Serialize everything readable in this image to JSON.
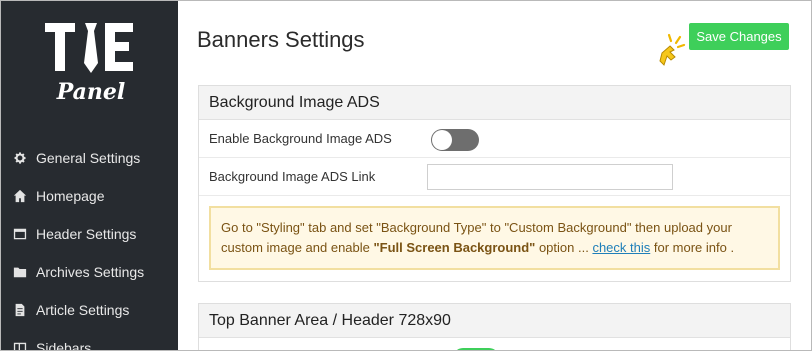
{
  "sidebar": {
    "logo_text": "TiE Panel",
    "items": [
      {
        "label": "General Settings",
        "icon": "gear-icon"
      },
      {
        "label": "Homepage",
        "icon": "home-icon"
      },
      {
        "label": "Header Settings",
        "icon": "window-icon"
      },
      {
        "label": "Archives Settings",
        "icon": "folder-icon"
      },
      {
        "label": "Article Settings",
        "icon": "document-icon"
      },
      {
        "label": "Sidebars",
        "icon": "columns-icon"
      }
    ]
  },
  "main": {
    "title": "Banners Settings",
    "save_label": "Save Changes",
    "sections": [
      {
        "title": "Background Image ADS",
        "enable_label": "Enable Background Image ADS",
        "enable_on": false,
        "link_label": "Background Image ADS Link",
        "link_value": "",
        "notice": {
          "part1": "Go to \"Styling\" tab and set \"Background Type\" to \"Custom Background\" then upload your custom image and enable ",
          "bold": "\"Full Screen Background\"",
          "part2": " option ... ",
          "link": "check this",
          "part3": " for more info ."
        }
      },
      {
        "title": "Top Banner Area / Header 728x90",
        "enable_on": true
      }
    ]
  },
  "colors": {
    "sidebar_bg": "#272b30",
    "accent_green": "#3ecf5a",
    "notice_border": "#f2dfa0",
    "notice_bg": "#fff8e5",
    "link": "#1f7fb9"
  }
}
